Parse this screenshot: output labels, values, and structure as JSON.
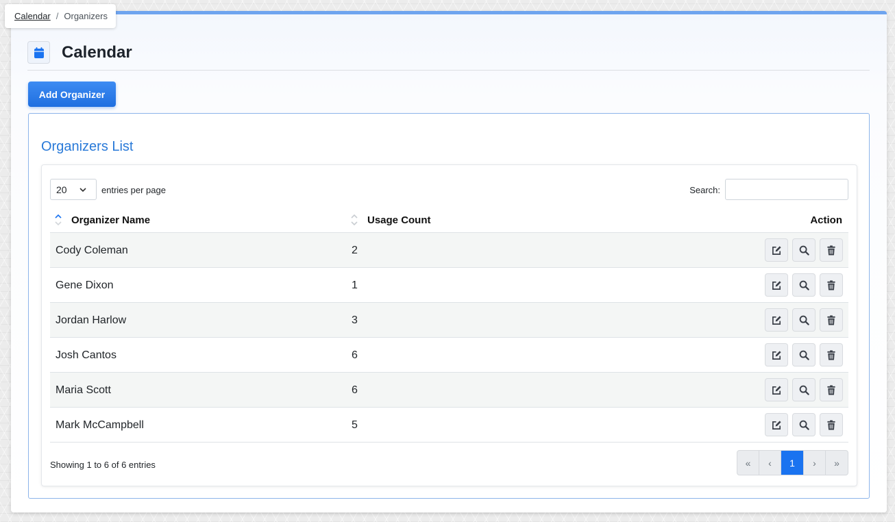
{
  "breadcrumb": {
    "home": "Calendar",
    "separator": "/",
    "current": "Organizers"
  },
  "header": {
    "title": "Calendar",
    "icon": "calendar-icon"
  },
  "toolbar": {
    "add_label": "Add Organizer"
  },
  "list": {
    "title": "Organizers List",
    "page_length": "20",
    "page_length_label": "entries per page",
    "search_label": "Search:",
    "search_value": "",
    "columns": {
      "name": "Organizer Name",
      "count": "Usage Count",
      "action": "Action"
    },
    "rows": [
      {
        "name": "Cody Coleman",
        "count": "2"
      },
      {
        "name": "Gene Dixon",
        "count": "1"
      },
      {
        "name": "Jordan Harlow",
        "count": "3"
      },
      {
        "name": "Josh Cantos",
        "count": "6"
      },
      {
        "name": "Maria Scott",
        "count": "6"
      },
      {
        "name": "Mark McCampbell",
        "count": "5"
      }
    ],
    "info": "Showing 1 to 6 of 6 entries",
    "pagination": {
      "first": "«",
      "prev": "‹",
      "current": "1",
      "next": "›",
      "last": "»"
    }
  },
  "colors": {
    "accent": "#1a73f0",
    "title_blue": "#2879d8",
    "top_border": "#6ea4ef",
    "button": "#2a7cea"
  }
}
